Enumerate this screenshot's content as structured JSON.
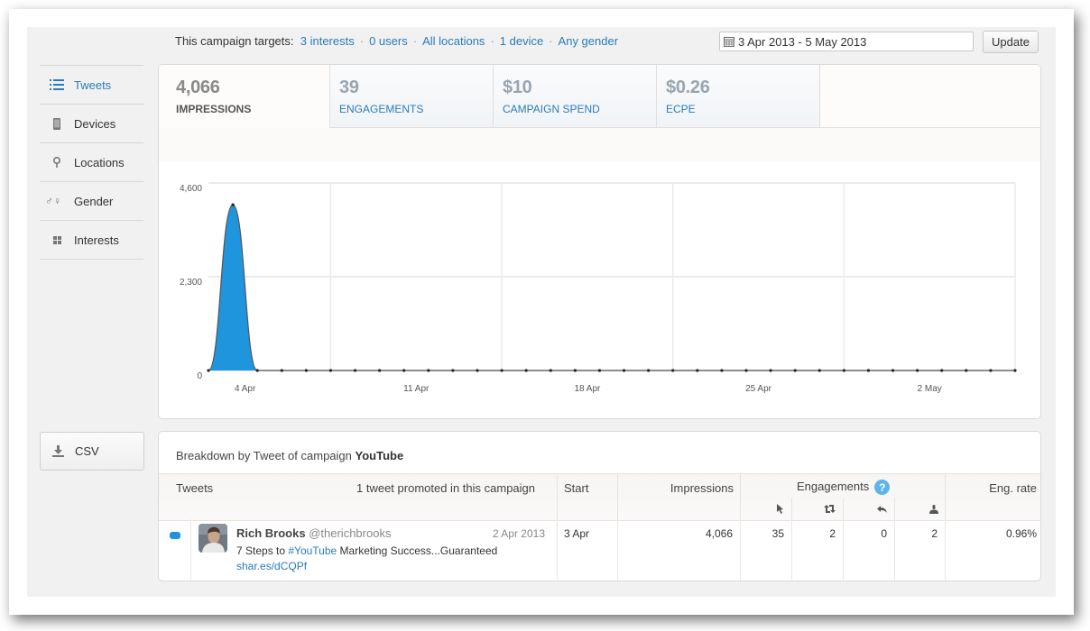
{
  "targets": {
    "prefix": "This campaign targets:",
    "links": [
      "3 interests",
      "0 users",
      "All locations",
      "1 device",
      "Any gender"
    ],
    "separator": "·"
  },
  "date_range": {
    "value": "3 Apr 2013 - 5 May 2013",
    "icon": "calendar-icon"
  },
  "update_button": "Update",
  "sidebar": {
    "items": [
      {
        "label": "Tweets",
        "icon": "list-icon",
        "active": true
      },
      {
        "label": "Devices",
        "icon": "phone-icon",
        "active": false
      },
      {
        "label": "Locations",
        "icon": "map-pin-icon",
        "active": false
      },
      {
        "label": "Gender",
        "icon": "gender-icon",
        "active": false
      },
      {
        "label": "Interests",
        "icon": "grid-icon",
        "active": false
      }
    ]
  },
  "csv_button": {
    "label": "CSV",
    "icon": "download-icon"
  },
  "stats_tabs": [
    {
      "value": "4,066",
      "label": "IMPRESSIONS",
      "active": true
    },
    {
      "value": "39",
      "label": "ENGAGEMENTS",
      "active": false
    },
    {
      "value": "$10",
      "label": "CAMPAIGN SPEND",
      "active": false
    },
    {
      "value": "$0.26",
      "label": "ECPE",
      "active": false
    }
  ],
  "colors": {
    "accent": "#2b7bb9",
    "area_fill": "#1e95dc",
    "line": "#555555",
    "grid": "#ebebeb"
  },
  "chart_data": {
    "type": "area",
    "title": "",
    "xlabel": "",
    "ylabel": "",
    "series": [
      {
        "name": "Impressions",
        "x": [
          "2 Apr",
          "3 Apr",
          "4 Apr",
          "5 Apr",
          "6 Apr",
          "7 Apr",
          "8 Apr",
          "9 Apr",
          "10 Apr",
          "11 Apr",
          "12 Apr",
          "13 Apr",
          "14 Apr",
          "15 Apr",
          "16 Apr",
          "17 Apr",
          "18 Apr",
          "19 Apr",
          "20 Apr",
          "21 Apr",
          "22 Apr",
          "23 Apr",
          "24 Apr",
          "25 Apr",
          "26 Apr",
          "27 Apr",
          "28 Apr",
          "29 Apr",
          "30 Apr",
          "1 May",
          "2 May",
          "3 May",
          "4 May",
          "5 May"
        ],
        "values": [
          0,
          4066,
          0,
          0,
          0,
          0,
          0,
          0,
          0,
          0,
          0,
          0,
          0,
          0,
          0,
          0,
          0,
          0,
          0,
          0,
          0,
          0,
          0,
          0,
          0,
          0,
          0,
          0,
          0,
          0,
          0,
          0,
          0,
          0
        ]
      }
    ],
    "ylim": [
      0,
      4600
    ],
    "yticks": [
      0,
      2300,
      4600
    ],
    "ytick_labels": [
      "0",
      "2,300",
      "4,600"
    ],
    "xtick_labels": [
      "4 Apr",
      "11 Apr",
      "18 Apr",
      "25 Apr",
      "2 May"
    ],
    "vertical_gridlines_at": [
      "7 Apr",
      "14 Apr",
      "21 Apr",
      "28 Apr",
      "5 May"
    ],
    "grid": true,
    "legend": "none"
  },
  "breakdown": {
    "title_prefix": "Breakdown by Tweet of campaign",
    "campaign": "YouTube",
    "headers": {
      "tweets": "Tweets",
      "promoted_count": "1 tweet promoted in this campaign",
      "start": "Start",
      "impressions": "Impressions",
      "engagements": "Engagements",
      "eng_rate": "Eng. rate",
      "engagement_icons": [
        "click-icon",
        "retweet-icon",
        "reply-icon",
        "follow-icon"
      ]
    },
    "rows": [
      {
        "author_name": "Rich Brooks",
        "handle": "@therichbrooks",
        "date": "2 Apr 2013",
        "text_before": "7 Steps to ",
        "hashtag": "#YouTube",
        "text_after": " Marketing Success...Guaranteed",
        "link": "shar.es/dCQPf",
        "start": "3 Apr",
        "impressions": "4,066",
        "clicks": "35",
        "retweets": "2",
        "replies": "0",
        "follows": "2",
        "eng_rate": "0.96%"
      }
    ]
  }
}
